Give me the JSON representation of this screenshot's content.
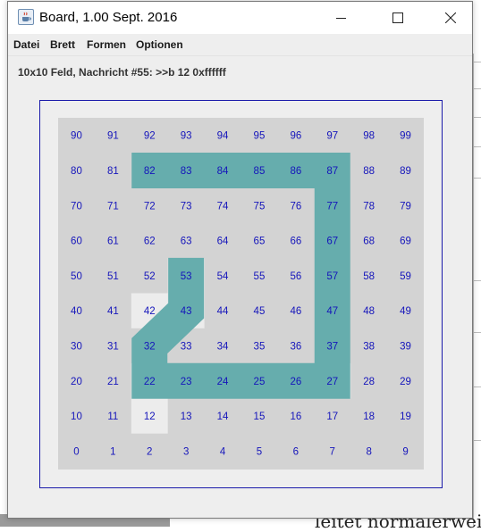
{
  "window": {
    "title": "Board, 1.00 Sept. 2016"
  },
  "icons": {
    "app": "java-cup-icon",
    "minimize": "minimize-icon",
    "maximize": "maximize-icon",
    "close": "close-icon"
  },
  "menu": {
    "items": [
      "Datei",
      "Brett",
      "Formen",
      "Optionen"
    ]
  },
  "status": {
    "text": "10x10 Feld, Nachricht #55: >>b 12 0xffffff"
  },
  "board": {
    "columns": 10,
    "rows": 10,
    "numbers_top_to_bottom": [
      [
        90,
        91,
        92,
        93,
        94,
        95,
        96,
        97,
        98,
        99
      ],
      [
        80,
        81,
        82,
        83,
        84,
        85,
        86,
        87,
        88,
        89
      ],
      [
        70,
        71,
        72,
        73,
        74,
        75,
        76,
        77,
        78,
        79
      ],
      [
        60,
        61,
        62,
        63,
        64,
        65,
        66,
        67,
        68,
        69
      ],
      [
        50,
        51,
        52,
        53,
        54,
        55,
        56,
        57,
        58,
        59
      ],
      [
        40,
        41,
        42,
        43,
        44,
        45,
        46,
        47,
        48,
        49
      ],
      [
        30,
        31,
        32,
        33,
        34,
        35,
        36,
        37,
        38,
        39
      ],
      [
        20,
        21,
        22,
        23,
        24,
        25,
        26,
        27,
        28,
        29
      ],
      [
        10,
        11,
        12,
        13,
        14,
        15,
        16,
        17,
        18,
        19
      ],
      [
        0,
        1,
        2,
        3,
        4,
        5,
        6,
        7,
        8,
        9
      ]
    ],
    "light_cells": [
      12,
      22,
      27,
      42,
      43,
      53
    ],
    "path_cells": [
      82,
      83,
      84,
      85,
      86,
      87,
      77,
      67,
      57,
      47,
      37,
      27,
      26,
      25,
      24,
      23,
      22,
      32,
      43,
      53
    ],
    "colors": {
      "background": "#d3d3d3",
      "light_cell": "#ececec",
      "path": "#66adad",
      "number": "#1515bb",
      "frame": "#1a1aaa"
    }
  },
  "background_document": {
    "text": "leitet normalerweise"
  }
}
